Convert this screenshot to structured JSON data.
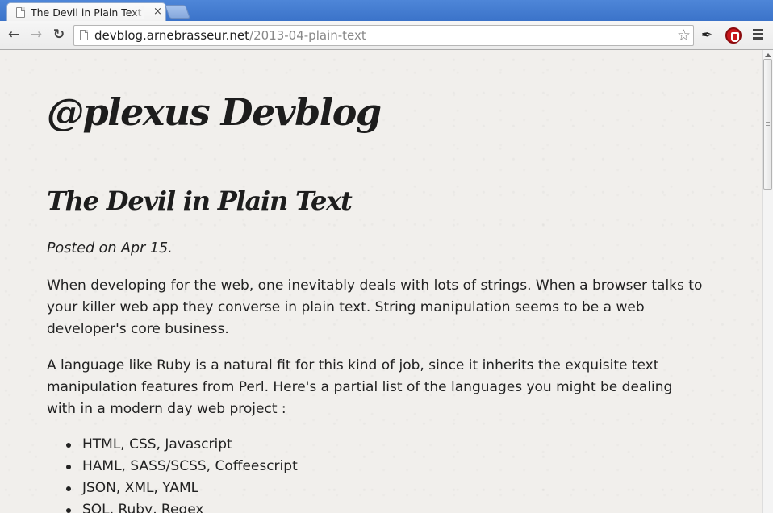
{
  "browser": {
    "tab": {
      "title": "The Devil in Plain Text",
      "close_glyph": "×",
      "favicon": "page-icon"
    },
    "nav": {
      "back_glyph": "←",
      "forward_glyph": "→",
      "reload_glyph": "↻"
    },
    "omnibox": {
      "host": "devblog.arnebrasseur.net",
      "path": "/2013-04-plain-text",
      "star_glyph": "☆"
    },
    "extensions": {
      "pin_glyph": "✒"
    }
  },
  "page": {
    "site_title": "@plexus Devblog",
    "post_title": "The Devil in Plain Text",
    "posted_on": "Posted on Apr 15.",
    "paragraphs": [
      "When developing for the web, one inevitably deals with lots of strings. When a browser talks to your killer web app they converse in plain text. String manipulation seems to be a web developer's core business.",
      "A language like Ruby is a natural fit for this kind of job, since it inherits the exquisite text manipulation features from Perl. Here's a partial list of the languages you might be dealing with in a modern day web project :"
    ],
    "languages": [
      "HTML, CSS, Javascript",
      "HAML, SASS/SCSS, Coffeescript",
      "JSON, XML, YAML",
      "SQL, Ruby, Regex"
    ]
  }
}
